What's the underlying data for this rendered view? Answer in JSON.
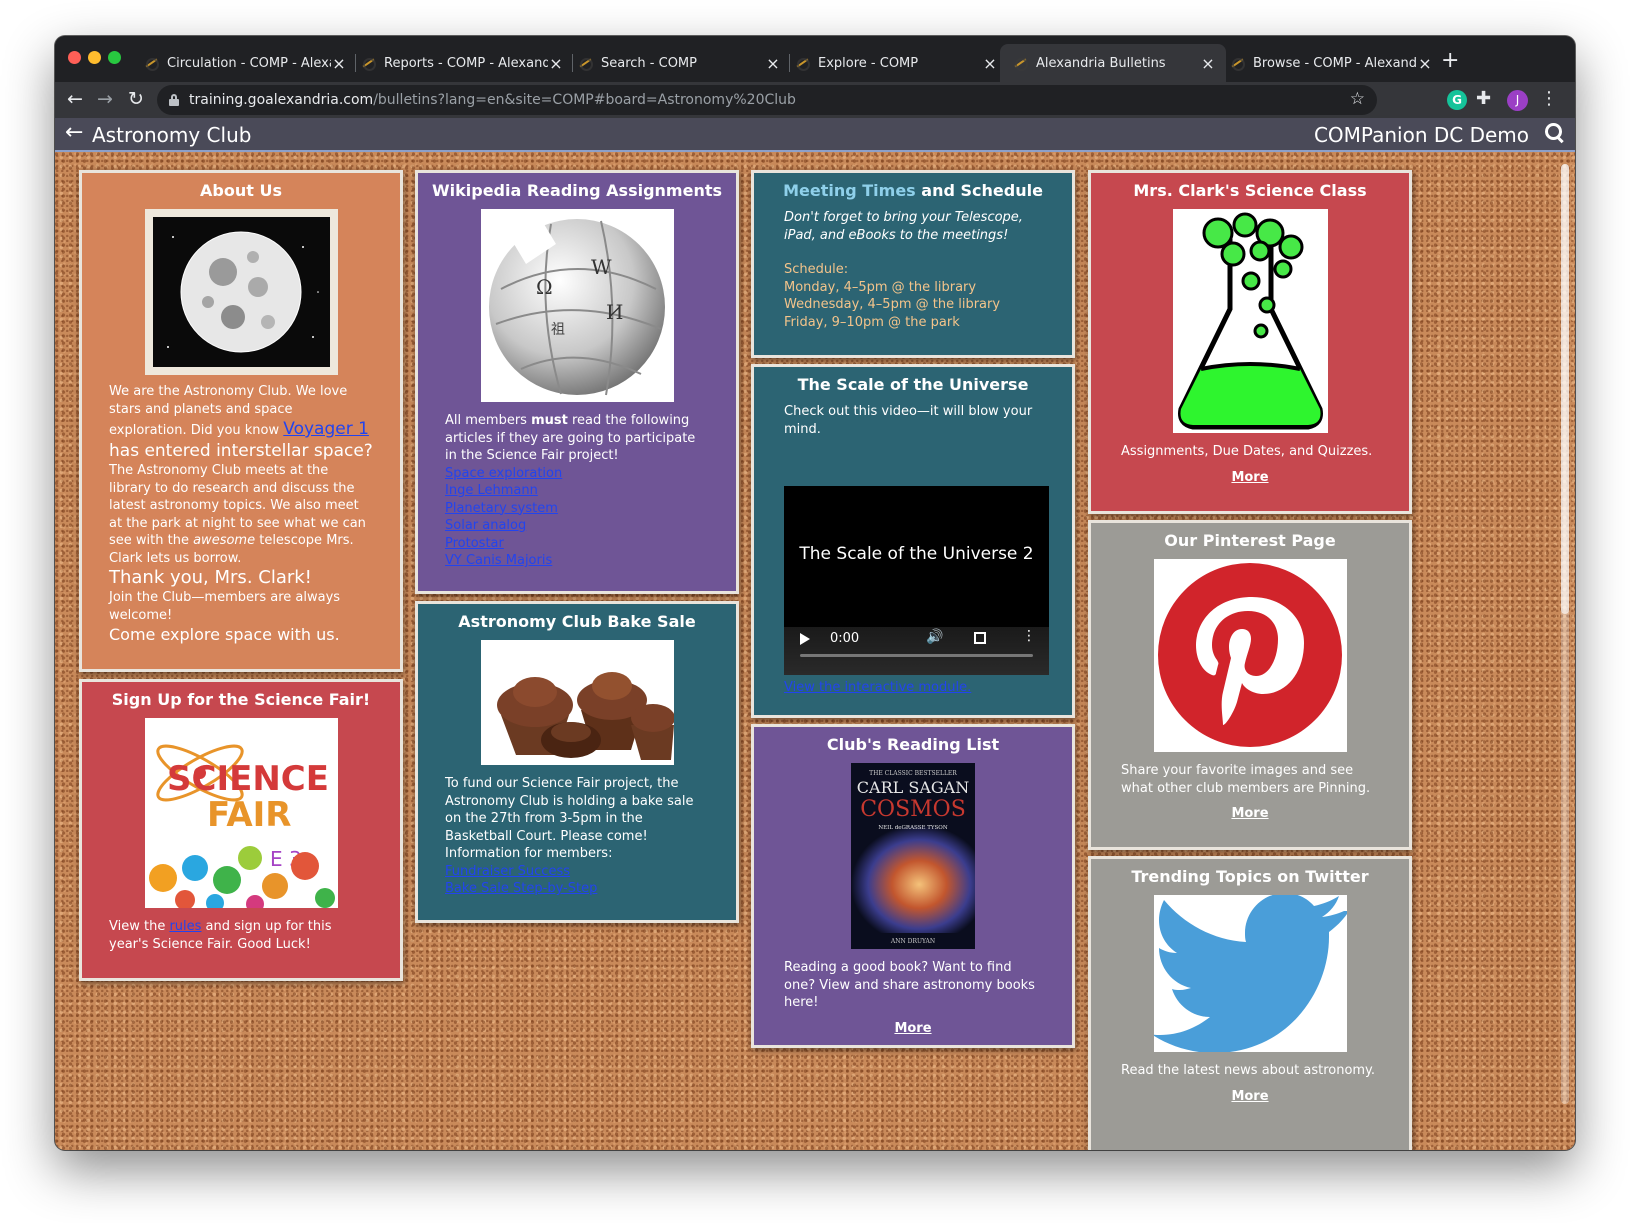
{
  "browser": {
    "tabs": [
      {
        "title": "Circulation - COMP - Alexandria"
      },
      {
        "title": "Reports - COMP - Alexandria"
      },
      {
        "title": "Search - COMP"
      },
      {
        "title": "Explore - COMP"
      },
      {
        "title": "Alexandria Bulletins"
      },
      {
        "title": "Browse - COMP - Alexandria"
      }
    ],
    "url_host": "training.goalexandria.com",
    "url_path": "/bulletins?lang=en&site=COMP#board=Astronomy%20Club",
    "avatar_letter": "J",
    "extension_letter": "G"
  },
  "appbar": {
    "title": "Astronomy Club",
    "right_title": "COMPanion DC Demo"
  },
  "cards": {
    "about": {
      "title": "About Us",
      "p1_a": "We are the Astronomy Club. We love stars and planets and space exploration. Did you know ",
      "link_voyager": "Voyager 1",
      "p1_b": " has entered interstellar space?",
      "p2_a": "The Astronomy Club meets at the library to do research and discuss the latest astronomy topics. We also meet at the park at night to see what we can see with the ",
      "p2_em": "awesome",
      "p2_b": " telescope Mrs. Clark lets us borrow.",
      "thanks": "Thank you, Mrs. Clark!",
      "join": "Join the Club—members are always welcome!",
      "explore": "Come explore space with us."
    },
    "signup": {
      "title": "Sign Up for the Science Fair!",
      "img_text_1": "SCIENCE",
      "img_text_2": "FAIR",
      "img_text_3": "E 3",
      "t1": "View the ",
      "link": "rules",
      "t2": " and sign up for this year's Science Fair. Good Luck!"
    },
    "wiki": {
      "title": "Wikipedia Reading Assignments",
      "t1": "All members ",
      "strong": "must",
      "t2": " read the following articles if they are going to participate in the Science Fair project!",
      "links": [
        "Space exploration",
        "Inge Lehmann",
        "Planetary system",
        "Solar analog",
        "Protostar",
        "VY Canis Majoris"
      ]
    },
    "bake": {
      "title": "Astronomy Club Bake Sale",
      "text": "To fund our Science Fair project, the Astronomy Club is holding a bake sale on the 27th from 3-5pm in the Basketball Court. Please come!",
      "info": "Information for members:",
      "links": [
        "Fundraiser Success",
        "Bake Sale Step-by-Step"
      ]
    },
    "meeting": {
      "title_a": "Meeting Times",
      "title_b": " and Schedule",
      "note": "Don't forget to bring your Telescope, iPad, and eBooks to the meetings!",
      "schedule_label": "Schedule:",
      "items": [
        "Monday, 4–5pm @ the library",
        "Wednesday, 4–5pm @ the library",
        "Friday, 9–10pm @ the park"
      ]
    },
    "scale": {
      "title": "The Scale of the Universe",
      "text": "Check out this video—it will blow your mind.",
      "video_title": "The Scale of the Universe 2",
      "time": "0:00",
      "link": "View the interactive module."
    },
    "reading": {
      "title": "Club's Reading List",
      "book_top": "THE CLASSIC BESTSELLER",
      "book_author": "CARL SAGAN",
      "book_title": "COSMOS",
      "book_foreword": "NEIL deGRASSE TYSON",
      "book_bottom": "ANN DRUYAN",
      "text": "Reading a good book? Want to find one? View and share astronomy books here!",
      "more": "More"
    },
    "clark": {
      "title": "Mrs. Clark's Science Class",
      "text": "Assignments, Due Dates, and Quizzes.",
      "more": "More"
    },
    "pinterest": {
      "title": "Our Pinterest Page",
      "text": "Share your favorite images and see what other club members are Pinning.",
      "more": "More"
    },
    "twitter": {
      "title": "Trending Topics on Twitter",
      "text": "Read the latest news about astronomy.",
      "more": "More"
    }
  },
  "colors": {
    "orange": "#d5845a",
    "red": "#c6484f",
    "purple": "#6f5596",
    "teal": "#2c6473",
    "gray": "#9c9b96",
    "link": "#2244ee",
    "cork": "#c98a5a"
  }
}
